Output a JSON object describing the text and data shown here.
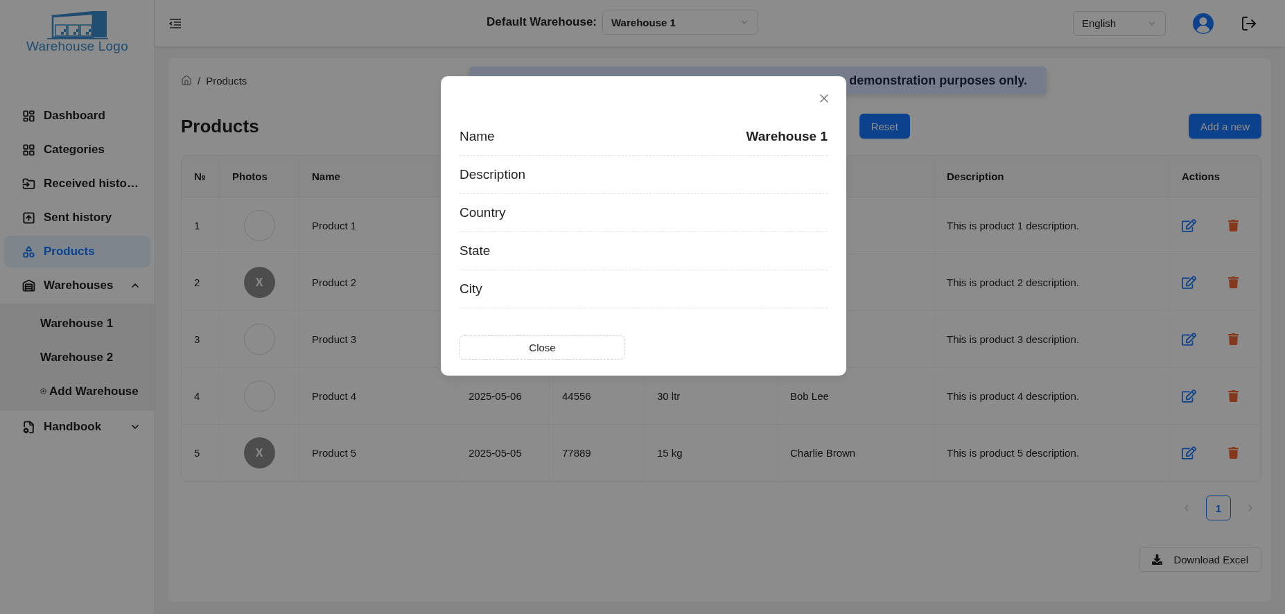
{
  "sidebar": {
    "logo_text": "Warehouse Logo",
    "items": [
      {
        "kind": "dashboard",
        "label": "Dashboard",
        "selected": false
      },
      {
        "kind": "categories",
        "label": "Categories",
        "selected": false
      },
      {
        "kind": "received",
        "label": "Received histo…",
        "selected": false
      },
      {
        "kind": "sent",
        "label": "Sent history",
        "selected": false
      },
      {
        "kind": "products",
        "label": "Products",
        "selected": true
      },
      {
        "kind": "warehouses",
        "label": "Warehouses",
        "selected": false,
        "expanded": true,
        "children": [
          {
            "kind": "link",
            "label": "Warehouse 1",
            "selected": false
          },
          {
            "kind": "link",
            "label": "Warehouse 2",
            "selected": false
          },
          {
            "kind": "add",
            "label": "Add Warehouse",
            "selected": false
          }
        ]
      },
      {
        "kind": "handbook",
        "label": "Handbook",
        "selected": false,
        "expanded": false
      }
    ]
  },
  "header": {
    "default_warehouse_label": "Default Warehouse:",
    "warehouse_select": {
      "value": "Warehouse 1"
    },
    "language_select": {
      "value": "English"
    }
  },
  "breadcrumb": {
    "separator": "/",
    "items": [
      "Products"
    ]
  },
  "notice": "demonstration purposes only.",
  "page_title": "Products",
  "reset_button": "Reset",
  "add_button": "Add a new",
  "table": {
    "columns": [
      {
        "label": "№"
      },
      {
        "label": "Photos"
      },
      {
        "label": "Name"
      },
      {
        "label": "Description"
      },
      {
        "label": "Actions"
      }
    ],
    "rows": [
      {
        "number": "1",
        "photo": {
          "kind": "empty"
        },
        "name": "Product 1",
        "description": "This is product 1 description."
      },
      {
        "number": "2",
        "photo": {
          "kind": "letter",
          "text": "X"
        },
        "name": "Product 2",
        "description": "This is product 2 description."
      },
      {
        "number": "3",
        "photo": {
          "kind": "empty"
        },
        "name": "Product 3",
        "description": "This is product 3 description."
      },
      {
        "number": "4",
        "photo": {
          "kind": "empty"
        },
        "name": "Product 4",
        "column_4": "2025-05-06",
        "column_5": "44556",
        "column_6": "30 ltr",
        "column_7": "Bob Lee",
        "description": "This is product 4 description."
      },
      {
        "number": "5",
        "photo": {
          "kind": "letter",
          "text": "X"
        },
        "name": "Product 5",
        "column_4": "2025-05-05",
        "column_5": "77889",
        "column_6": "15 kg",
        "column_7": "Charlie Brown",
        "description": "This is product 5 description."
      }
    ]
  },
  "pagination": {
    "prev": {
      "disabled": true
    },
    "pages": [
      {
        "label": "1",
        "selected": true
      }
    ],
    "next": {
      "disabled": true
    }
  },
  "download_button": "Download Excel",
  "modal": {
    "fields": [
      {
        "label": "Name",
        "value": "Warehouse 1"
      },
      {
        "label": "Description"
      },
      {
        "label": "Country"
      },
      {
        "label": "State"
      },
      {
        "label": "City"
      }
    ],
    "close_button": "Close"
  }
}
